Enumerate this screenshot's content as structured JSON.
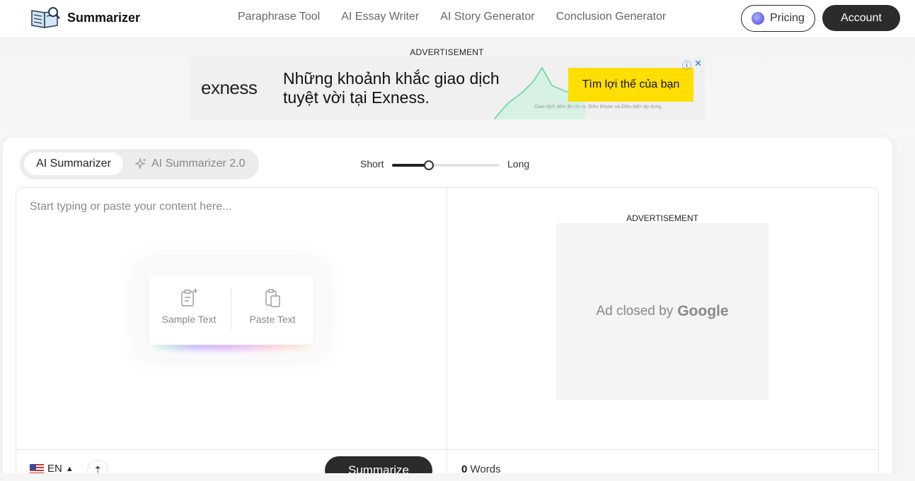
{
  "header": {
    "logo_text": "Summarizer",
    "nav": [
      "Paraphrase Tool",
      "AI Essay Writer",
      "AI Story Generator",
      "Conclusion Generator"
    ],
    "pricing_label": "Pricing",
    "account_label": "Account"
  },
  "top_ad": {
    "label": "ADVERTISEMENT",
    "brand": "exness",
    "headline": "Những khoảnh khắc giao dịch tuyệt vời tại Exness.",
    "cta": "Tìm lợi thế của bạn",
    "fine_print": "Giao dịch tiềm ẩn rủi ro. Điều khoản và Điều kiện áp dụng.",
    "accent_color": "#ffde02"
  },
  "tool": {
    "mode_active": "AI Summarizer",
    "mode_alt": "AI Summarizer 2.0",
    "length_short": "Short",
    "length_long": "Long",
    "length_value": 0.34
  },
  "editor": {
    "placeholder": "Start typing or paste your content here...",
    "sample_text_label": "Sample Text",
    "paste_text_label": "Paste Text",
    "language": "EN",
    "summarize_label": "Summarize"
  },
  "output": {
    "word_count": "0",
    "words_label": "Words"
  },
  "side_ad": {
    "label": "ADVERTISEMENT",
    "closed_text": "Ad closed by",
    "closed_brand": "Google"
  }
}
